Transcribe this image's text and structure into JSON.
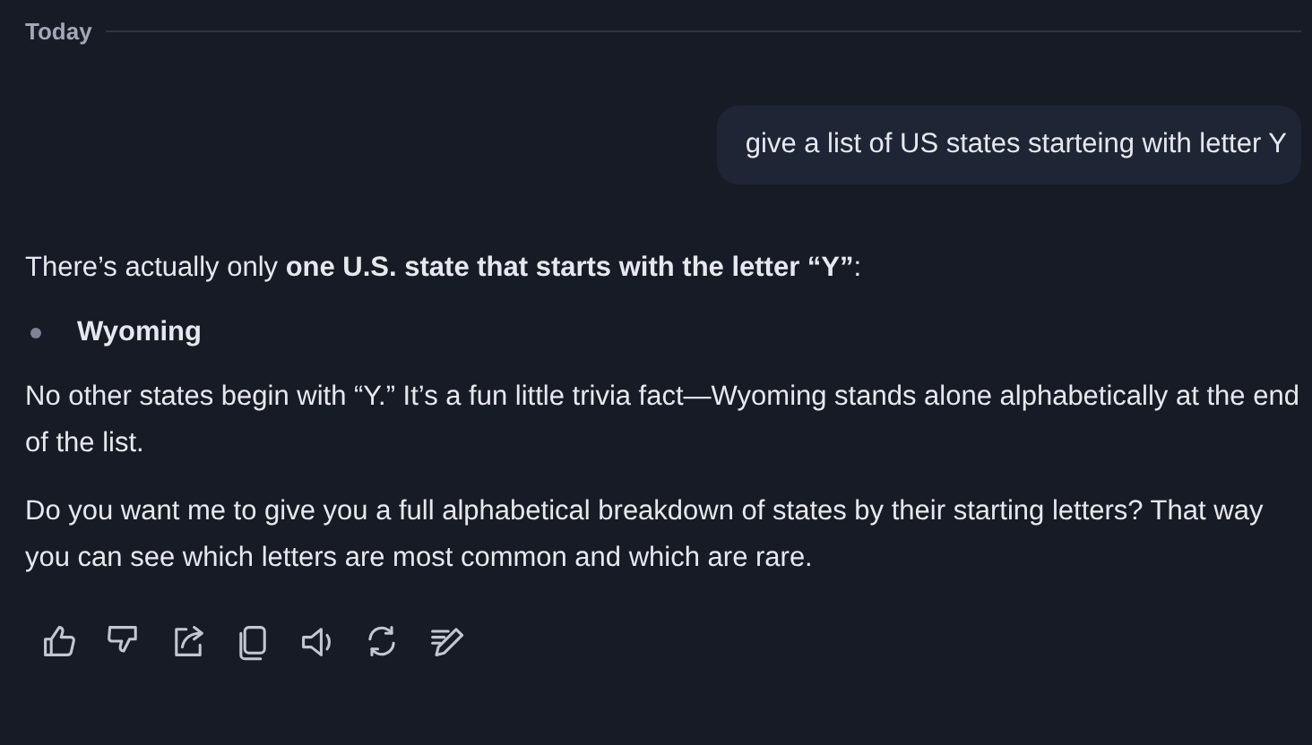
{
  "divider": {
    "label": "Today"
  },
  "user_message": {
    "text": "give a list of US states starteing with letter Y"
  },
  "reply": [
    {
      "kind": "paragraph",
      "text": "There’s actually only **one U.S. state that starts with the letter “Y”**:"
    },
    {
      "kind": "bullet",
      "text": "Wyoming"
    },
    {
      "kind": "paragraph",
      "text": "No other states begin with “Y.” It’s a fun little trivia fact—Wyoming stands alone alphabetically at the end of the list."
    },
    {
      "kind": "paragraph",
      "text": "Do you want me to give you a full alphabetical breakdown of states by their starting letters? That way you can see which letters are most common and which are rare."
    }
  ]
}
